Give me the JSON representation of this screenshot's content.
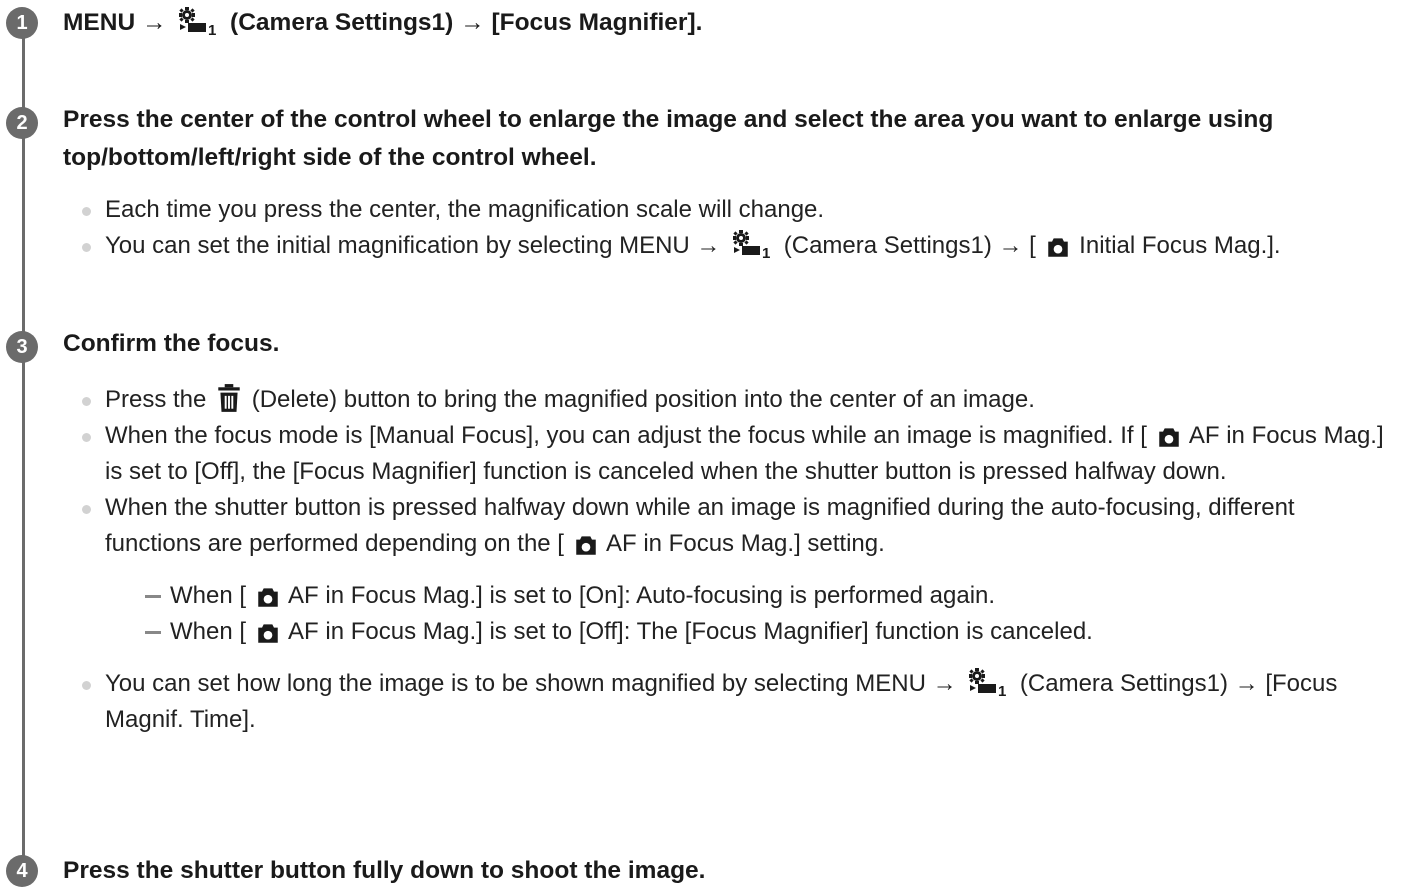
{
  "steps": [
    {
      "number": "1",
      "heading": {
        "pre": "MENU → ",
        "post": " (Camera Settings1) → [Focus Magnifier]."
      }
    },
    {
      "number": "2",
      "heading": "Press the center of the control wheel to enlarge the image and select the area you want to enlarge using top/bottom/left/right side of the control wheel.",
      "bullets": [
        {
          "text": "Each time you press the center, the magnification scale will change."
        },
        {
          "pre": "You can set the initial magnification by selecting MENU → ",
          "mid": " (Camera Settings1) → [ ",
          "post": " Initial Focus Mag.]."
        }
      ]
    },
    {
      "number": "3",
      "heading": "Confirm the focus.",
      "bullets": [
        {
          "pre": "Press the ",
          "post": " (Delete) button to bring the magnified position into the center of an image."
        },
        {
          "pre": "When the focus mode is [Manual Focus], you can adjust the focus while an image is magnified. If [ ",
          "post": " AF in Focus Mag.] is set to [Off], the [Focus Magnifier] function is canceled when the shutter button is pressed halfway down."
        },
        {
          "pre": "When the shutter button is pressed halfway down while an image is magnified during the auto-focusing, different functions are performed depending on the [ ",
          "post": " AF in Focus Mag.] setting."
        },
        {
          "pre": "You can set how long the image is to be shown magnified by selecting MENU → ",
          "post": " (Camera Settings1) → [Focus Magnif. Time]."
        }
      ],
      "dashes": [
        {
          "pre": "When [ ",
          "post": " AF in Focus Mag.] is set to [On]: Auto-focusing is performed again."
        },
        {
          "pre": "When [ ",
          "post": " AF in Focus Mag.] is set to [Off]: The [Focus Magnifier] function is canceled."
        }
      ]
    },
    {
      "number": "4",
      "heading": "Press the shutter button fully down to shoot the image."
    }
  ],
  "icons": {
    "camera_settings": "camera-settings1-icon",
    "still_camera": "still-camera-icon",
    "delete": "trash-icon"
  },
  "colors": {
    "rail": "#6b6b6b",
    "text": "#1a1a1a",
    "bullet": "#d2d2d2"
  }
}
